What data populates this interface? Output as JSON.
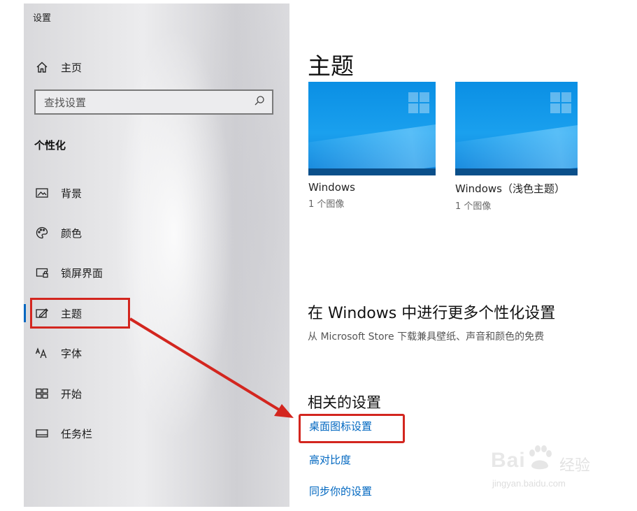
{
  "window": {
    "title": "设置"
  },
  "sidebar": {
    "home_label": "主页",
    "search": {
      "placeholder": "查找设置"
    },
    "section_heading": "个性化",
    "items": [
      {
        "label": "背景",
        "icon": "picture-icon"
      },
      {
        "label": "颜色",
        "icon": "palette-icon"
      },
      {
        "label": "锁屏界面",
        "icon": "lock-screen-icon"
      },
      {
        "label": "主题",
        "icon": "theme-icon",
        "selected": true
      },
      {
        "label": "字体",
        "icon": "font-icon"
      },
      {
        "label": "开始",
        "icon": "start-icon"
      },
      {
        "label": "任务栏",
        "icon": "taskbar-icon"
      }
    ]
  },
  "main": {
    "page_title": "主题",
    "themes": [
      {
        "name": "Windows",
        "count": "1 个图像"
      },
      {
        "name": "Windows（浅色主题）",
        "count": "1 个图像"
      }
    ],
    "more": {
      "title": "在 Windows 中进行更多个性化设置",
      "description": "从 Microsoft Store 下载兼具壁纸、声音和颜色的免费"
    },
    "related": {
      "title": "相关的设置",
      "links": [
        "桌面图标设置",
        "高对比度",
        "同步你的设置"
      ]
    }
  },
  "watermark": {
    "brand": "Bai",
    "brand_cn": "经验",
    "url": "jingyan.baidu.com"
  },
  "colors": {
    "accent": "#0067c0",
    "annotation": "#d3261f"
  }
}
